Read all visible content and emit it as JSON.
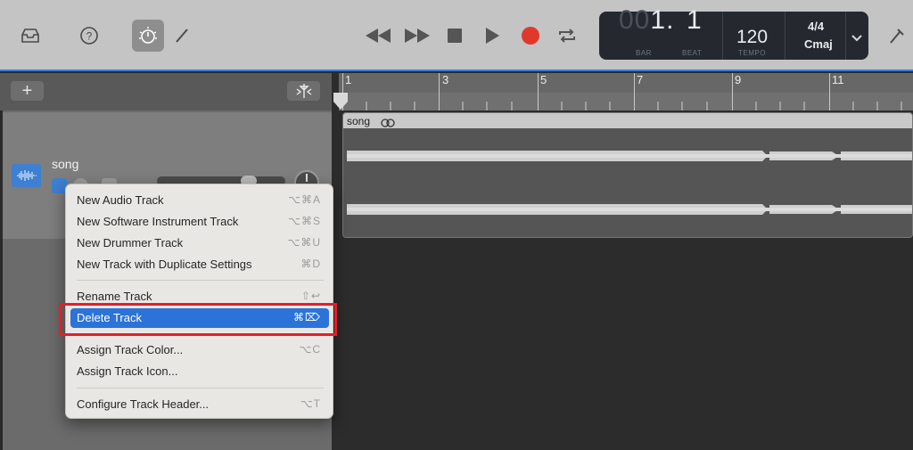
{
  "toolbar": {
    "icons": [
      "library-icon",
      "help-icon",
      "smart-controls-icon",
      "editors-icon",
      "rewind-icon",
      "fast-forward-icon",
      "stop-icon",
      "play-icon",
      "record-icon",
      "cycle-icon",
      "tuner-icon"
    ],
    "record_color": "#e0392b"
  },
  "lcd": {
    "bar_dim": "00",
    "bar_value": "1",
    "beat_value": "1",
    "bar_label": "BAR",
    "beat_label": "BEAT",
    "tempo": "120",
    "tempo_label": "TEMPO",
    "time_signature": "4/4",
    "key": "Cmaj"
  },
  "track_header": {
    "add_label": "+"
  },
  "track": {
    "name": "song",
    "icon": "waveform-icon",
    "color": "#3e7fd1"
  },
  "ruler": {
    "bars": [
      "1",
      "3",
      "5",
      "7",
      "9",
      "11"
    ]
  },
  "region": {
    "name": "song"
  },
  "context_menu": {
    "groups": [
      [
        {
          "label": "New Audio Track",
          "shortcut": "⌥⌘A"
        },
        {
          "label": "New Software Instrument Track",
          "shortcut": "⌥⌘S"
        },
        {
          "label": "New Drummer Track",
          "shortcut": "⌥⌘U"
        },
        {
          "label": "New Track with Duplicate Settings",
          "shortcut": "⌘D"
        }
      ],
      [
        {
          "label": "Rename Track",
          "shortcut": "⇧↩"
        },
        {
          "label": "Delete Track",
          "shortcut": "⌘⌦",
          "selected": true
        }
      ],
      [
        {
          "label": "Assign Track Color...",
          "shortcut": "⌥C"
        },
        {
          "label": "Assign Track Icon...",
          "shortcut": ""
        }
      ],
      [
        {
          "label": "Configure Track Header...",
          "shortcut": "⌥T"
        }
      ]
    ],
    "accent": "#2b73d8",
    "highlight_border": "#e0202a"
  }
}
